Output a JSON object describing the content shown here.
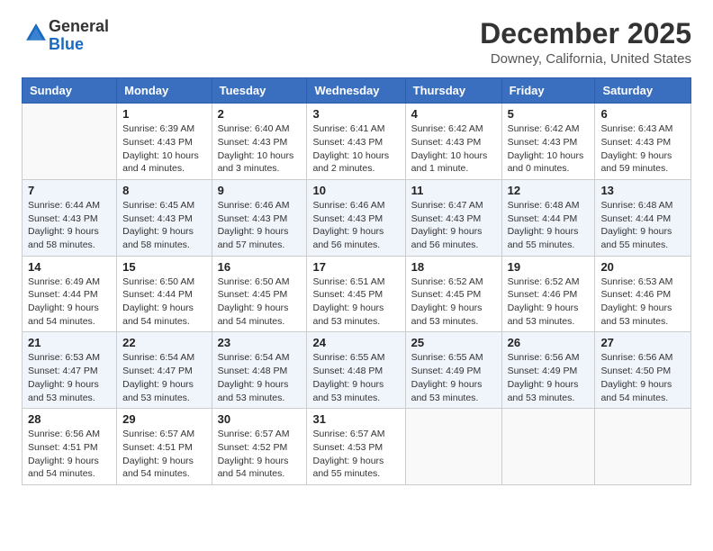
{
  "logo": {
    "general": "General",
    "blue": "Blue"
  },
  "title": "December 2025",
  "location": "Downey, California, United States",
  "weekdays": [
    "Sunday",
    "Monday",
    "Tuesday",
    "Wednesday",
    "Thursday",
    "Friday",
    "Saturday"
  ],
  "weeks": [
    [
      {
        "day": "",
        "info": ""
      },
      {
        "day": "1",
        "info": "Sunrise: 6:39 AM\nSunset: 4:43 PM\nDaylight: 10 hours\nand 4 minutes."
      },
      {
        "day": "2",
        "info": "Sunrise: 6:40 AM\nSunset: 4:43 PM\nDaylight: 10 hours\nand 3 minutes."
      },
      {
        "day": "3",
        "info": "Sunrise: 6:41 AM\nSunset: 4:43 PM\nDaylight: 10 hours\nand 2 minutes."
      },
      {
        "day": "4",
        "info": "Sunrise: 6:42 AM\nSunset: 4:43 PM\nDaylight: 10 hours\nand 1 minute."
      },
      {
        "day": "5",
        "info": "Sunrise: 6:42 AM\nSunset: 4:43 PM\nDaylight: 10 hours\nand 0 minutes."
      },
      {
        "day": "6",
        "info": "Sunrise: 6:43 AM\nSunset: 4:43 PM\nDaylight: 9 hours\nand 59 minutes."
      }
    ],
    [
      {
        "day": "7",
        "info": "Sunrise: 6:44 AM\nSunset: 4:43 PM\nDaylight: 9 hours\nand 58 minutes."
      },
      {
        "day": "8",
        "info": "Sunrise: 6:45 AM\nSunset: 4:43 PM\nDaylight: 9 hours\nand 58 minutes."
      },
      {
        "day": "9",
        "info": "Sunrise: 6:46 AM\nSunset: 4:43 PM\nDaylight: 9 hours\nand 57 minutes."
      },
      {
        "day": "10",
        "info": "Sunrise: 6:46 AM\nSunset: 4:43 PM\nDaylight: 9 hours\nand 56 minutes."
      },
      {
        "day": "11",
        "info": "Sunrise: 6:47 AM\nSunset: 4:43 PM\nDaylight: 9 hours\nand 56 minutes."
      },
      {
        "day": "12",
        "info": "Sunrise: 6:48 AM\nSunset: 4:44 PM\nDaylight: 9 hours\nand 55 minutes."
      },
      {
        "day": "13",
        "info": "Sunrise: 6:48 AM\nSunset: 4:44 PM\nDaylight: 9 hours\nand 55 minutes."
      }
    ],
    [
      {
        "day": "14",
        "info": "Sunrise: 6:49 AM\nSunset: 4:44 PM\nDaylight: 9 hours\nand 54 minutes."
      },
      {
        "day": "15",
        "info": "Sunrise: 6:50 AM\nSunset: 4:44 PM\nDaylight: 9 hours\nand 54 minutes."
      },
      {
        "day": "16",
        "info": "Sunrise: 6:50 AM\nSunset: 4:45 PM\nDaylight: 9 hours\nand 54 minutes."
      },
      {
        "day": "17",
        "info": "Sunrise: 6:51 AM\nSunset: 4:45 PM\nDaylight: 9 hours\nand 53 minutes."
      },
      {
        "day": "18",
        "info": "Sunrise: 6:52 AM\nSunset: 4:45 PM\nDaylight: 9 hours\nand 53 minutes."
      },
      {
        "day": "19",
        "info": "Sunrise: 6:52 AM\nSunset: 4:46 PM\nDaylight: 9 hours\nand 53 minutes."
      },
      {
        "day": "20",
        "info": "Sunrise: 6:53 AM\nSunset: 4:46 PM\nDaylight: 9 hours\nand 53 minutes."
      }
    ],
    [
      {
        "day": "21",
        "info": "Sunrise: 6:53 AM\nSunset: 4:47 PM\nDaylight: 9 hours\nand 53 minutes."
      },
      {
        "day": "22",
        "info": "Sunrise: 6:54 AM\nSunset: 4:47 PM\nDaylight: 9 hours\nand 53 minutes."
      },
      {
        "day": "23",
        "info": "Sunrise: 6:54 AM\nSunset: 4:48 PM\nDaylight: 9 hours\nand 53 minutes."
      },
      {
        "day": "24",
        "info": "Sunrise: 6:55 AM\nSunset: 4:48 PM\nDaylight: 9 hours\nand 53 minutes."
      },
      {
        "day": "25",
        "info": "Sunrise: 6:55 AM\nSunset: 4:49 PM\nDaylight: 9 hours\nand 53 minutes."
      },
      {
        "day": "26",
        "info": "Sunrise: 6:56 AM\nSunset: 4:49 PM\nDaylight: 9 hours\nand 53 minutes."
      },
      {
        "day": "27",
        "info": "Sunrise: 6:56 AM\nSunset: 4:50 PM\nDaylight: 9 hours\nand 54 minutes."
      }
    ],
    [
      {
        "day": "28",
        "info": "Sunrise: 6:56 AM\nSunset: 4:51 PM\nDaylight: 9 hours\nand 54 minutes."
      },
      {
        "day": "29",
        "info": "Sunrise: 6:57 AM\nSunset: 4:51 PM\nDaylight: 9 hours\nand 54 minutes."
      },
      {
        "day": "30",
        "info": "Sunrise: 6:57 AM\nSunset: 4:52 PM\nDaylight: 9 hours\nand 54 minutes."
      },
      {
        "day": "31",
        "info": "Sunrise: 6:57 AM\nSunset: 4:53 PM\nDaylight: 9 hours\nand 55 minutes."
      },
      {
        "day": "",
        "info": ""
      },
      {
        "day": "",
        "info": ""
      },
      {
        "day": "",
        "info": ""
      }
    ]
  ]
}
